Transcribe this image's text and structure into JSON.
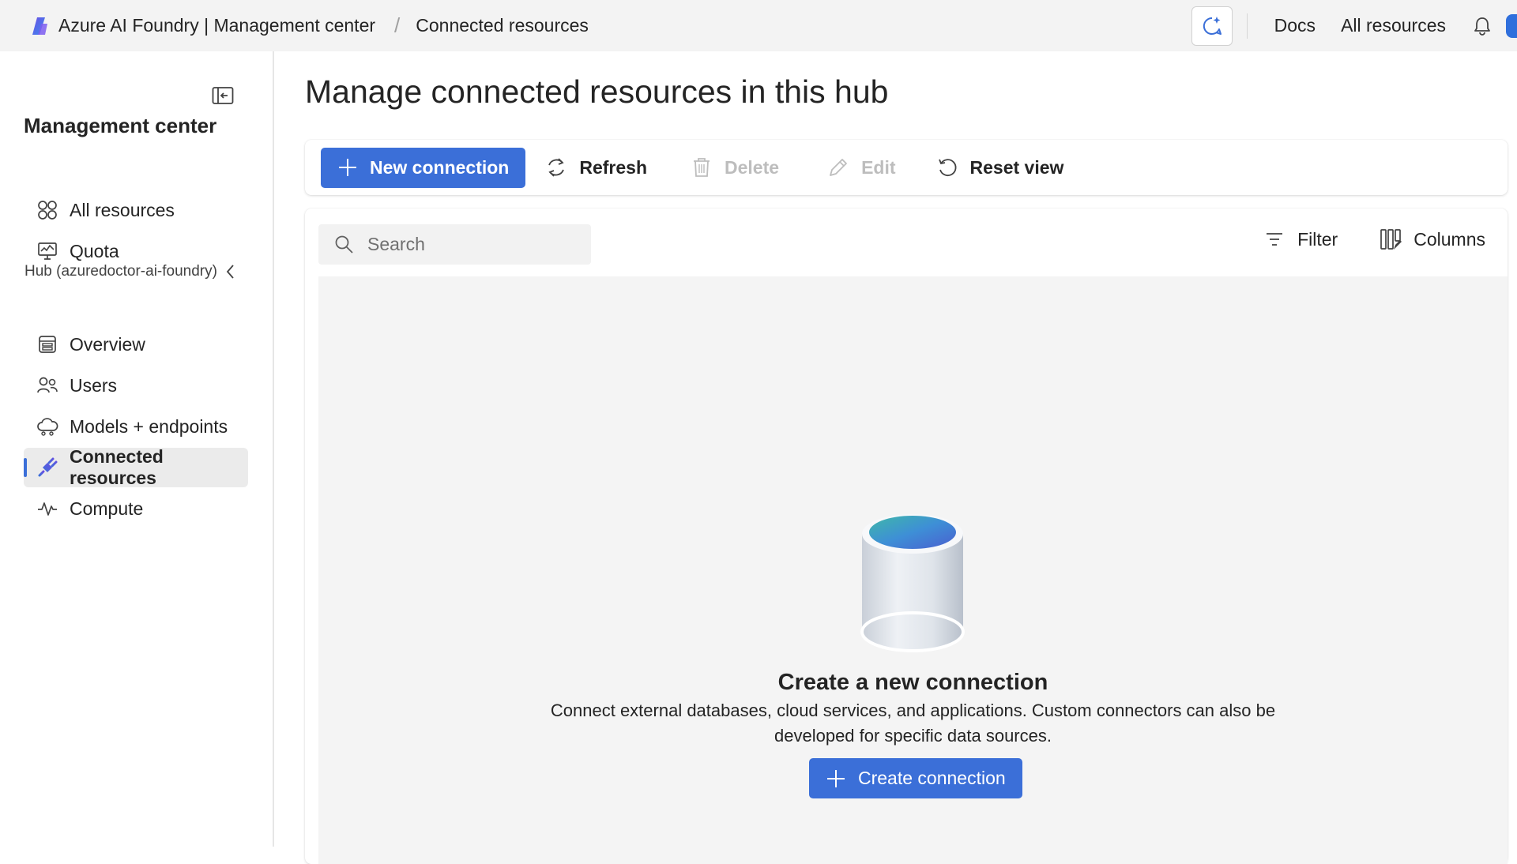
{
  "topbar": {
    "app_title": "Azure AI Foundry | Management center",
    "breadcrumb_separator": "/",
    "breadcrumb_current": "Connected resources",
    "links": [
      "Docs",
      "All resources"
    ]
  },
  "sidebar": {
    "title": "Management center",
    "top_items": [
      {
        "label": "All resources",
        "icon": "grid-icon"
      },
      {
        "label": "Quota",
        "icon": "quota-monitor-icon"
      }
    ],
    "hub_label": "Hub (azuredoctor-ai-foundry)",
    "hub_items": [
      {
        "label": "Overview",
        "icon": "overview-icon"
      },
      {
        "label": "Users",
        "icon": "users-icon"
      },
      {
        "label": "Models + endpoints",
        "icon": "cloud-models-icon"
      },
      {
        "label": "Connected resources",
        "icon": "plug-icon",
        "active": true
      },
      {
        "label": "Compute",
        "icon": "pulse-icon"
      }
    ]
  },
  "main": {
    "page_title": "Manage connected resources in this hub",
    "toolbar": {
      "new_connection": "New connection",
      "refresh": "Refresh",
      "delete": "Delete",
      "edit": "Edit",
      "reset_view": "Reset view"
    },
    "search": {
      "placeholder": "Search",
      "value": ""
    },
    "filter_label": "Filter",
    "columns_label": "Columns",
    "empty_state": {
      "title": "Create a new connection",
      "description": "Connect external databases, cloud services, and applications. Custom connectors can also be developed for specific data sources.",
      "button_label": "Create connection"
    }
  },
  "colors": {
    "accent": "#3b6fd8",
    "topbar_bg": "#f3f3f3",
    "empty_bg": "#f4f4f4"
  }
}
